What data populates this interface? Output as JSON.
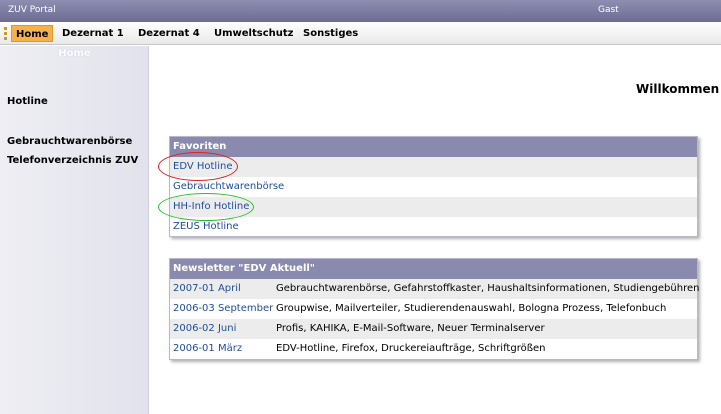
{
  "app_title": "ZUV Portal",
  "user": "Gast",
  "nav": [
    "Home",
    "Dezernat 1",
    "Dezernat 4",
    "Umweltschutz",
    "Sonstiges"
  ],
  "sidebar": {
    "header": "Home",
    "items": [
      "Hotline",
      "Gebrauchtwarenbörse",
      "Telefonverzeichnis ZUV"
    ]
  },
  "welcome": "Willkommen im",
  "favorites": {
    "title": "Favoriten",
    "items": [
      "EDV Hotline",
      "Gebrauchtwarenbörse",
      "HH-Info Hotline",
      "ZEUS Hotline"
    ]
  },
  "newsletter": {
    "title": "Newsletter \"EDV Aktuell\"",
    "rows": [
      {
        "date": "2007-01 April",
        "text": "Gebrauchtwarenbörse, Gefahrstoffkaster, Haushaltsinformationen, Studiengebühren"
      },
      {
        "date": "2006-03 September",
        "text": "Groupwise, Mailverteiler, Studierendenauswahl, Bologna Prozess, Telefonbuch"
      },
      {
        "date": "2006-02 Juni",
        "text": "Profis, KAHIKA, E-Mail-Software, Neuer Terminalserver"
      },
      {
        "date": "2006-01 März",
        "text": "EDV-Hotline, Firefox, Druckereiaufträge, Schriftgrößen"
      }
    ]
  },
  "colors": {
    "header_bar": "#8a8aae",
    "nav_active": "#f6b24a",
    "link": "#1f4c9a",
    "annotation_red": "#e02020",
    "annotation_green": "#22c422"
  }
}
